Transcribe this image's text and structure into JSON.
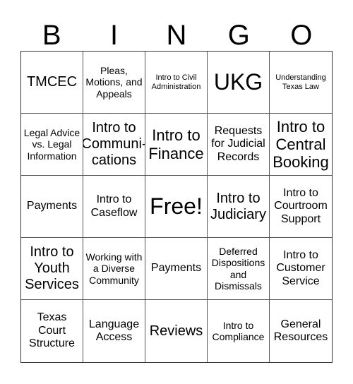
{
  "header": {
    "letters": [
      "B",
      "I",
      "N",
      "G",
      "O"
    ]
  },
  "card": {
    "cells": [
      "TMCEC",
      "Pleas, Motions, and Appeals",
      "Intro to Civil Administration",
      "UKG",
      "Understanding Texas Law",
      "Legal Advice vs. Legal Information",
      "Intro to Communi-cations",
      "Intro to Finance",
      "Requests for Judicial Records",
      "Intro to Central Booking",
      "Payments",
      "Intro to Caseflow",
      "Free!",
      "Intro to Judiciary",
      "Intro to Courtroom Support",
      "Intro to Youth Services",
      "Working with a Diverse Community",
      "Payments",
      "Deferred Dispositions and Dismissals",
      "Intro to Customer Service",
      "Texas Court Structure",
      "Language Access",
      "Reviews",
      "Intro to Compliance",
      "General Resources"
    ],
    "free_space_index": 12
  }
}
